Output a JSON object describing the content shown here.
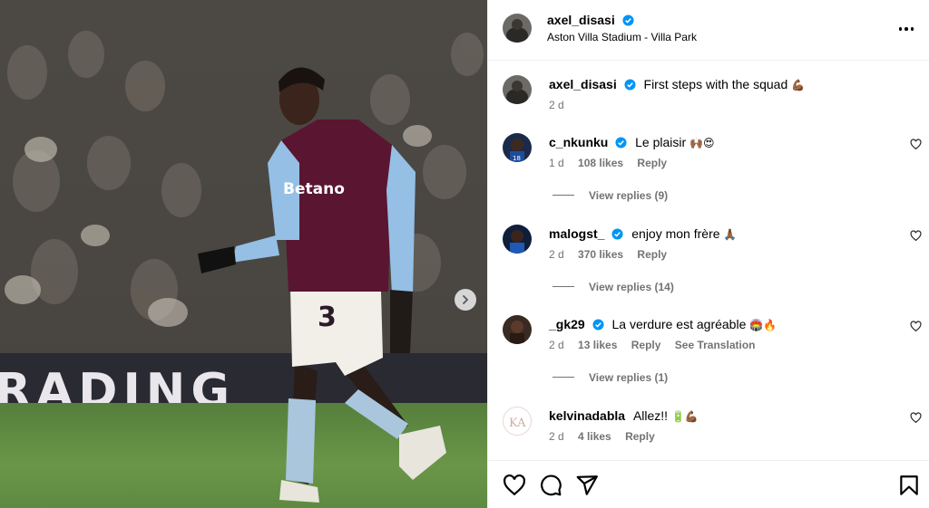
{
  "post": {
    "author": "axel_disasi",
    "location": "Aston Villa Stadium - Villa Park",
    "caption_text": "First steps with the squad",
    "caption_emoji": "💪🏾",
    "caption_age": "2 d",
    "sponsor_board_text": "RADING",
    "more_icon": "more-horizontal-icon"
  },
  "comments": [
    {
      "username": "c_nkunku",
      "text": "Le plaisir",
      "emoji": "🙌🏾😍",
      "age": "1 d",
      "likes": "108 likes",
      "reply": "Reply",
      "view_replies": "View replies (9)"
    },
    {
      "username": "malogst_",
      "text": "enjoy mon frère",
      "emoji": "🙏🏾",
      "age": "2 d",
      "likes": "370 likes",
      "reply": "Reply",
      "view_replies": "View replies (14)"
    },
    {
      "username": "_gk29",
      "text": "La verdure est agréable",
      "emoji": "🏟️🔥",
      "age": "2 d",
      "likes": "13 likes",
      "reply": "Reply",
      "translation": "See Translation",
      "view_replies": "View replies (1)"
    },
    {
      "username": "kelvinadabla",
      "text": "Allez!!",
      "emoji": "🔋💪🏾",
      "age": "2 d",
      "likes": "4 likes",
      "reply": "Reply"
    }
  ],
  "actions": {
    "icons": [
      "heart-icon",
      "comment-icon",
      "share-icon",
      "bookmark-icon"
    ]
  },
  "colors": {
    "verified_blue": "#0095f6",
    "meta_gray": "#737373",
    "divider": "#efefef",
    "kit_claret": "#670e36",
    "kit_sky_blue": "#95bfe5"
  }
}
